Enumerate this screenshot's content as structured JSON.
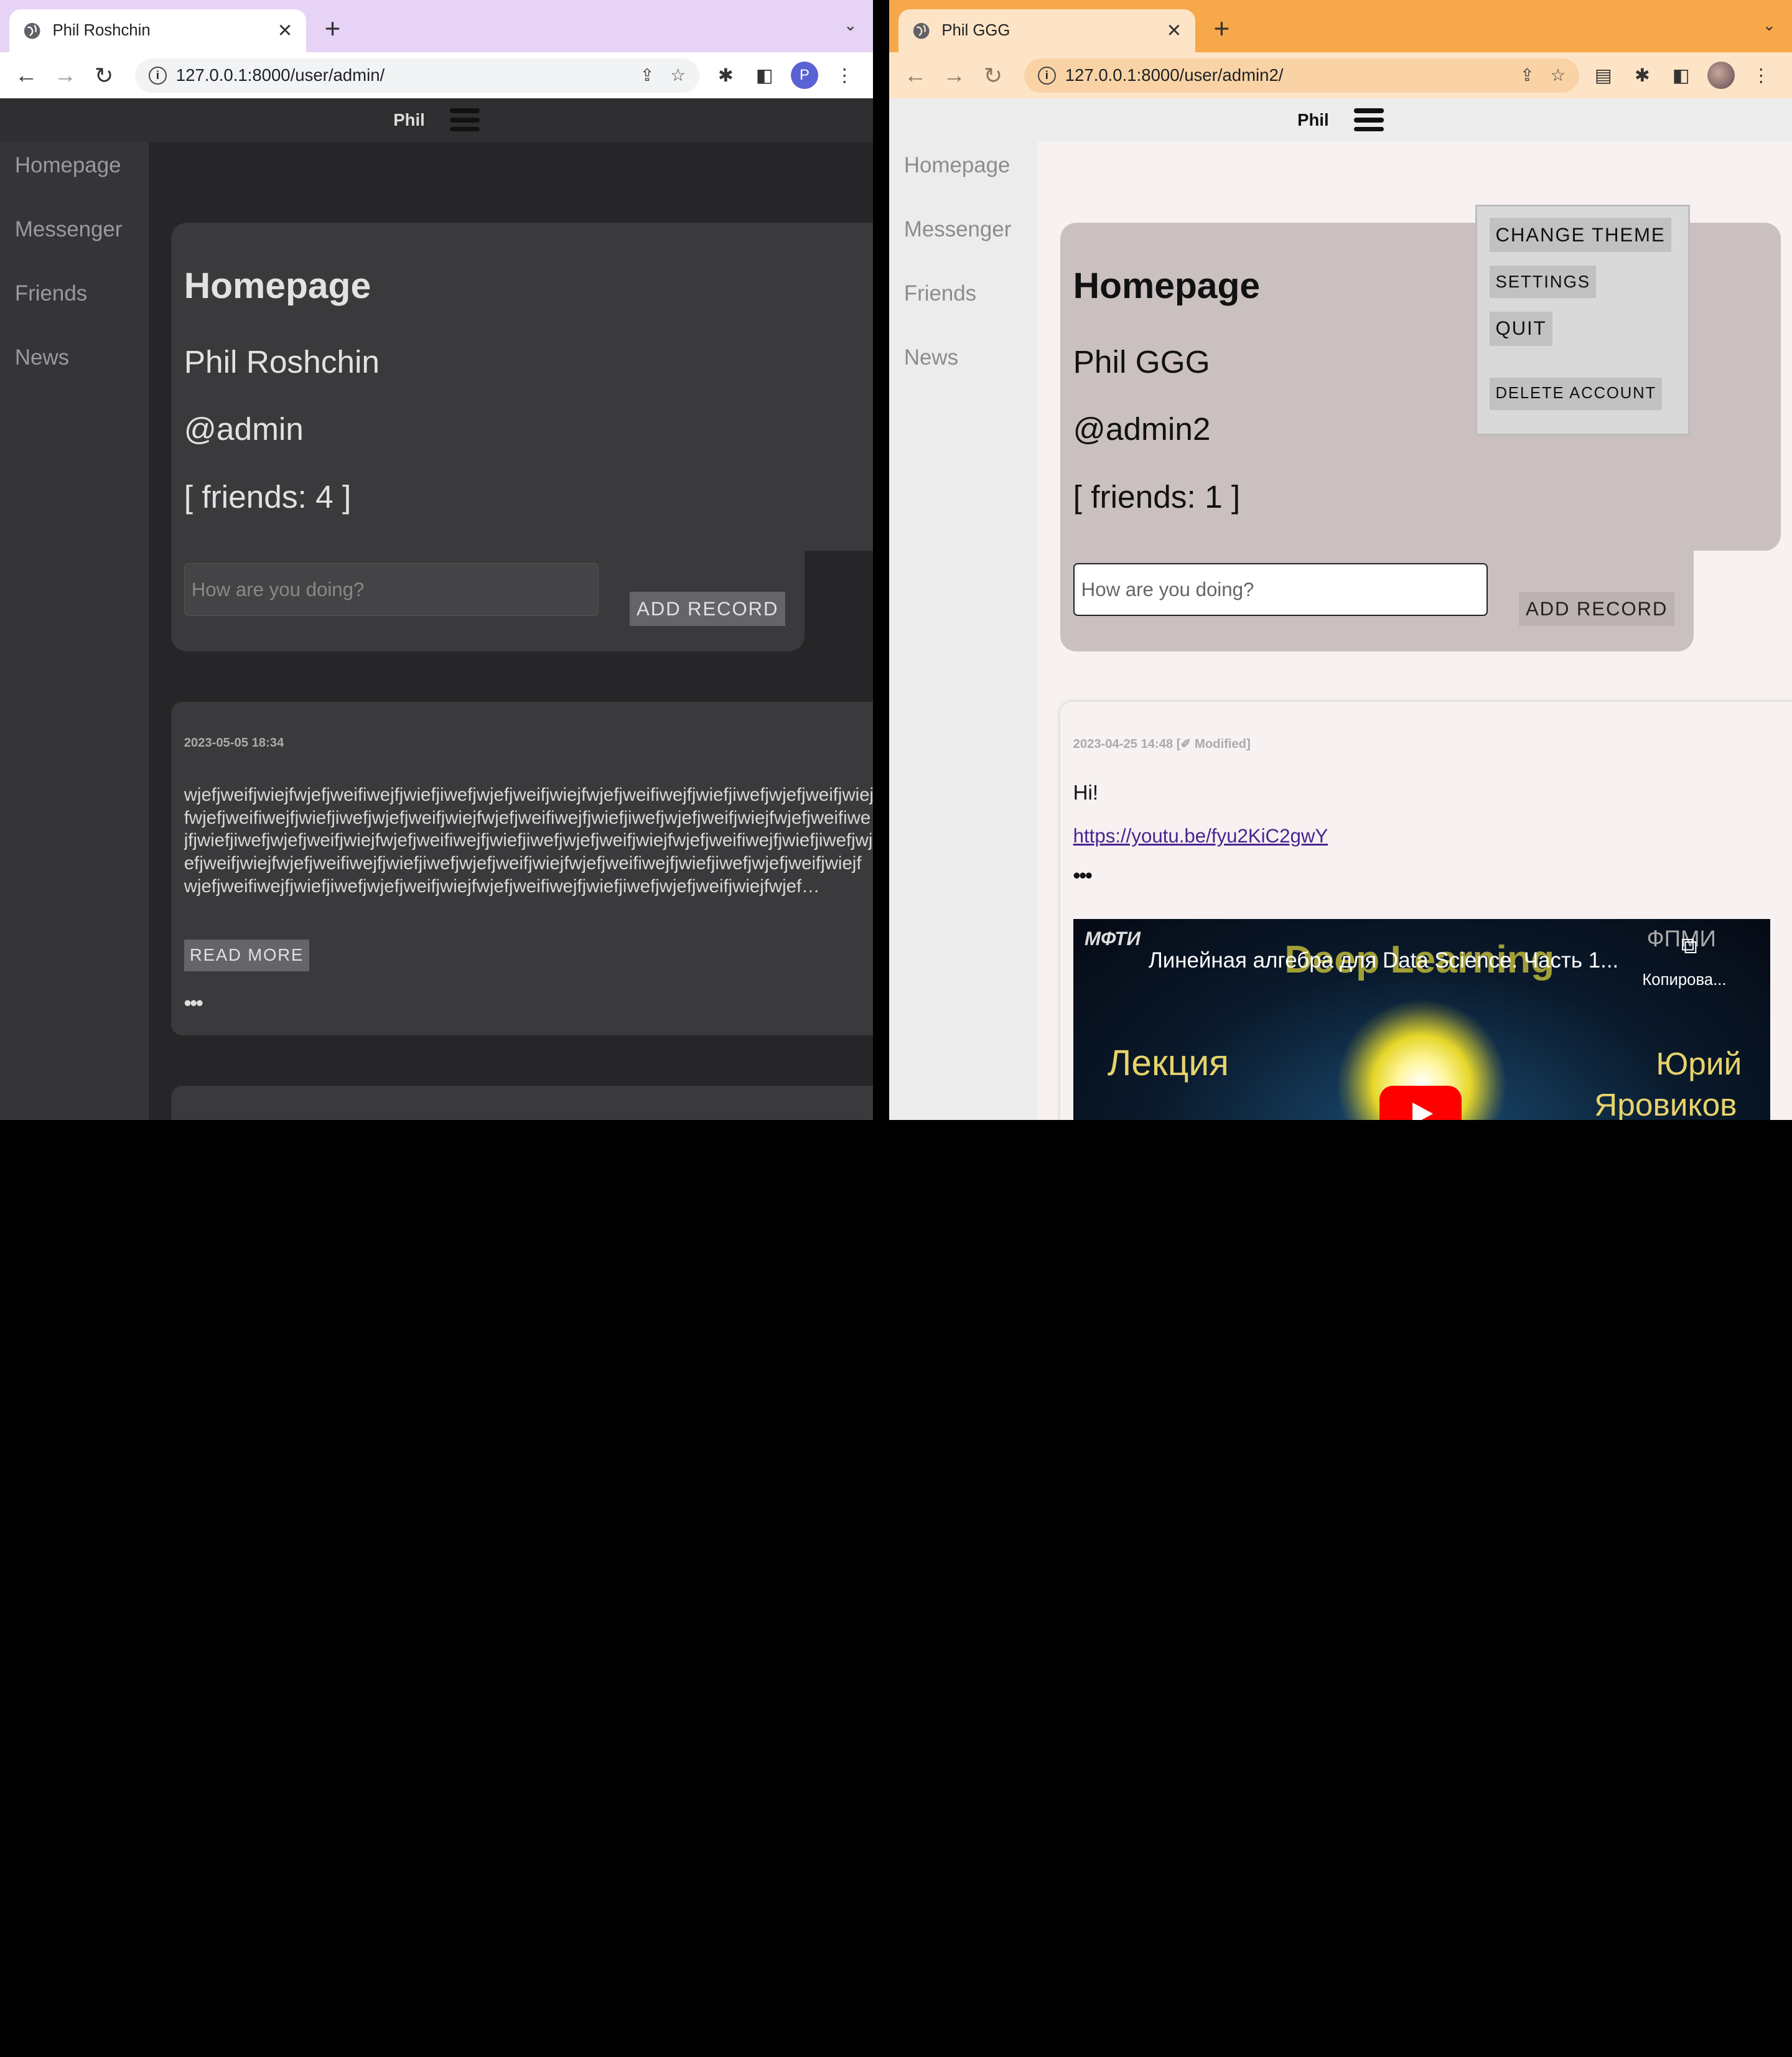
{
  "left_window": {
    "tab_title": "Phil Roshchin",
    "url": "127.0.0.1:8000/user/admin/",
    "profile_initial": "P",
    "header_username": "Phil",
    "sidebar": [
      "Homepage",
      "Messenger",
      "Friends",
      "News"
    ],
    "profile": {
      "title": "Homepage",
      "name": "Phil Roshchin",
      "handle": "@admin",
      "friends": "[ friends: 4 ]"
    },
    "record_placeholder": "How are you doing?",
    "add_record_label": "ADD RECORD",
    "post": {
      "date": "2023-05-05 18:34",
      "text": "wjefjweifjwiejfwjefjweifiwejfjwiefjiwefjwjefjweifjwiejfwjefjweifiwejfjwiefjiwefjwjefjweifjwiejfwjefjweifiwejfjwiefjiwefjwjefjweifjwiejfwjefjweifiwejfjwiefjiwefjwjefjweifjwiejfwjefjweifiwejfjwiefjiwefjwjefjweifjwiejfwjefjweifiwejfjwiefjiwefjwjefjweifjwiejfwjefjweifiwejfjwiefjiwefjwjefjweifjwiejfwjefjweifiwejfjwiefjiwefjwjefjweifjwiejfwjefjweifiwejfjwiefjiwefjwjefjweifjwiejfwjefjweifiwejfjwiefjiwefjwjefjweifjwiejfwjefjweifiwejfjwiefjiwefjwjefjweifjwiejfwjef…",
      "read_more_label": "READ MORE",
      "more_dots": "•••"
    }
  },
  "right_window": {
    "tab_title": "Phil GGG",
    "url": "127.0.0.1:8000/user/admin2/",
    "header_username": "Phil",
    "sidebar": [
      "Homepage",
      "Messenger",
      "Friends",
      "News"
    ],
    "menu": {
      "change_theme": "CHANGE THEME",
      "settings": "SETTINGS",
      "quit": "QUIT",
      "delete_account": "DELETE ACCOUNT"
    },
    "profile": {
      "title": "Homepage",
      "name": "Phil GGG",
      "handle": "@admin2",
      "friends": "[ friends: 1 ]"
    },
    "record_placeholder": "How are you doing?",
    "add_record_label": "ADD RECORD",
    "post": {
      "date": "2023-04-25 14:48 [✐ Modified]",
      "text": "Hi!",
      "link": "https://youtu.be/fyu2KiC2gwY",
      "more_dots": "•••",
      "video": {
        "title": "Линейная алгебра для Data Science. Часть 1...",
        "bg_title": "Deep Learning",
        "channel_logo": "МФТИ",
        "fpmi_logo": "ФПМИ",
        "copy_label": "Копирова...",
        "lecture_word": "Лекция",
        "author_first": "Юрий",
        "author_last": "Яровиков"
      }
    }
  }
}
